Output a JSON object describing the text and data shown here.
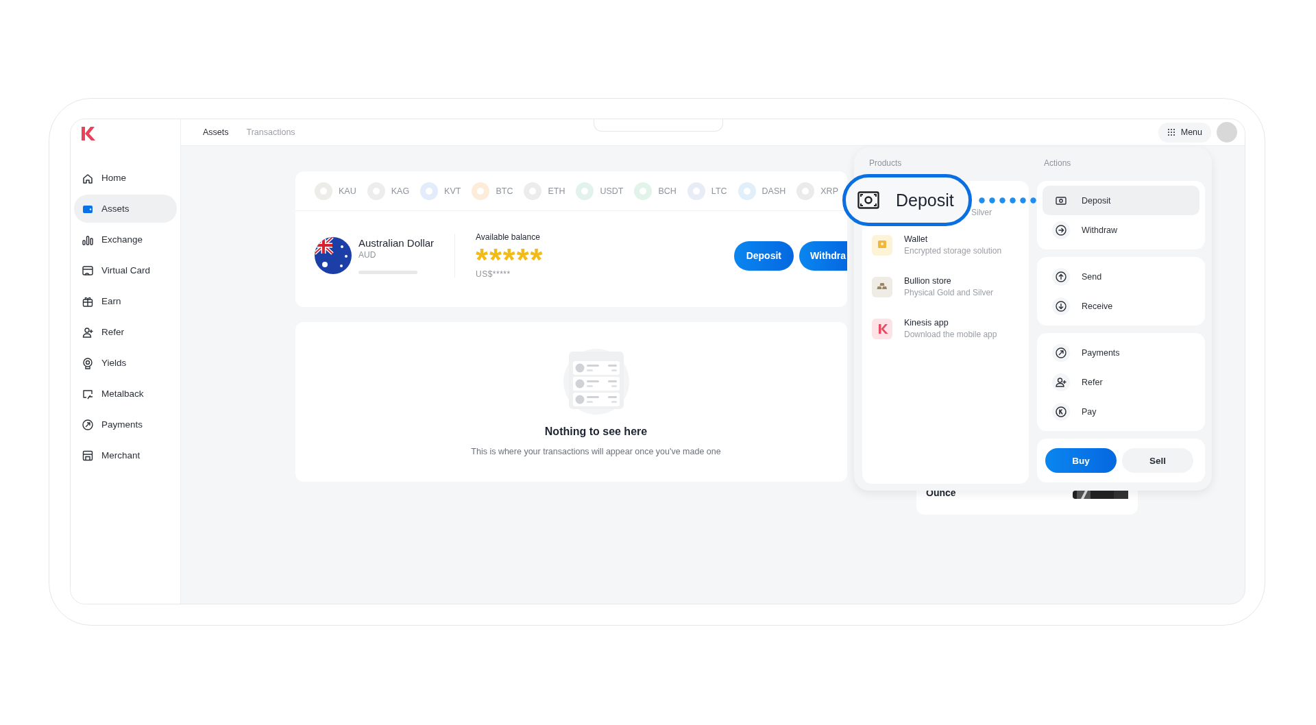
{
  "tabs": [
    {
      "label": "Assets",
      "selected": true
    },
    {
      "label": "Transactions",
      "selected": false
    }
  ],
  "menu_button": {
    "label": "Menu"
  },
  "sidebar": {
    "items": [
      {
        "label": "Home",
        "selected": false
      },
      {
        "label": "Assets",
        "selected": true
      },
      {
        "label": "Exchange",
        "selected": false
      },
      {
        "label": "Virtual Card",
        "selected": false
      },
      {
        "label": "Earn",
        "selected": false
      },
      {
        "label": "Refer",
        "selected": false
      },
      {
        "label": "Yields",
        "selected": false
      },
      {
        "label": "Metalback",
        "selected": false
      },
      {
        "label": "Payments",
        "selected": false
      },
      {
        "label": "Merchant",
        "selected": false
      }
    ]
  },
  "coins": [
    {
      "label": "KAU",
      "color": "#eeece8"
    },
    {
      "label": "KAG",
      "color": "#ededed"
    },
    {
      "label": "KVT",
      "color": "#e2ecfb"
    },
    {
      "label": "BTC",
      "color": "#fdecda"
    },
    {
      "label": "ETH",
      "color": "#ececec"
    },
    {
      "label": "USDT",
      "color": "#e1f3ec"
    },
    {
      "label": "BCH",
      "color": "#e0f4e9"
    },
    {
      "label": "LTC",
      "color": "#e7ecf6"
    },
    {
      "label": "DASH",
      "color": "#e1effb"
    },
    {
      "label": "XRP",
      "color": "#ebebeb"
    }
  ],
  "balance": {
    "currency_name": "Australian Dollar",
    "currency_code": "AUD",
    "label": "Available balance",
    "amount": "*****",
    "usd_amount": "US$*****"
  },
  "balance_buttons": [
    "Deposit",
    "Withdra"
  ],
  "empty_state": {
    "title": "Nothing to see here",
    "text": "This is where your transactions will appear once you've made one"
  },
  "side_card": {
    "label": "Ounce"
  },
  "popup": {
    "products_title": "Products",
    "actions_title": "Actions",
    "products": [
      {
        "subtitle": "Silver"
      },
      {
        "name": "Wallet",
        "subtitle": "Encrypted storage solution"
      },
      {
        "name": "Bullion store",
        "subtitle": "Physical Gold and Silver"
      },
      {
        "name": "Kinesis app",
        "subtitle": "Download the mobile app"
      }
    ],
    "action_groups": [
      {
        "items": [
          {
            "label": "Deposit",
            "selected": true
          },
          {
            "label": "Withdraw",
            "selected": false
          }
        ]
      },
      {
        "items": [
          {
            "label": "Send",
            "selected": false
          },
          {
            "label": "Receive",
            "selected": false
          }
        ]
      },
      {
        "items": [
          {
            "label": "Payments",
            "selected": false
          },
          {
            "label": "Refer",
            "selected": false
          },
          {
            "label": "Pay",
            "selected": false
          }
        ]
      }
    ],
    "trade_buttons": [
      {
        "label": "Buy",
        "selected": true
      },
      {
        "label": "Sell",
        "selected": false
      }
    ]
  },
  "callout": {
    "label": "Deposit"
  }
}
